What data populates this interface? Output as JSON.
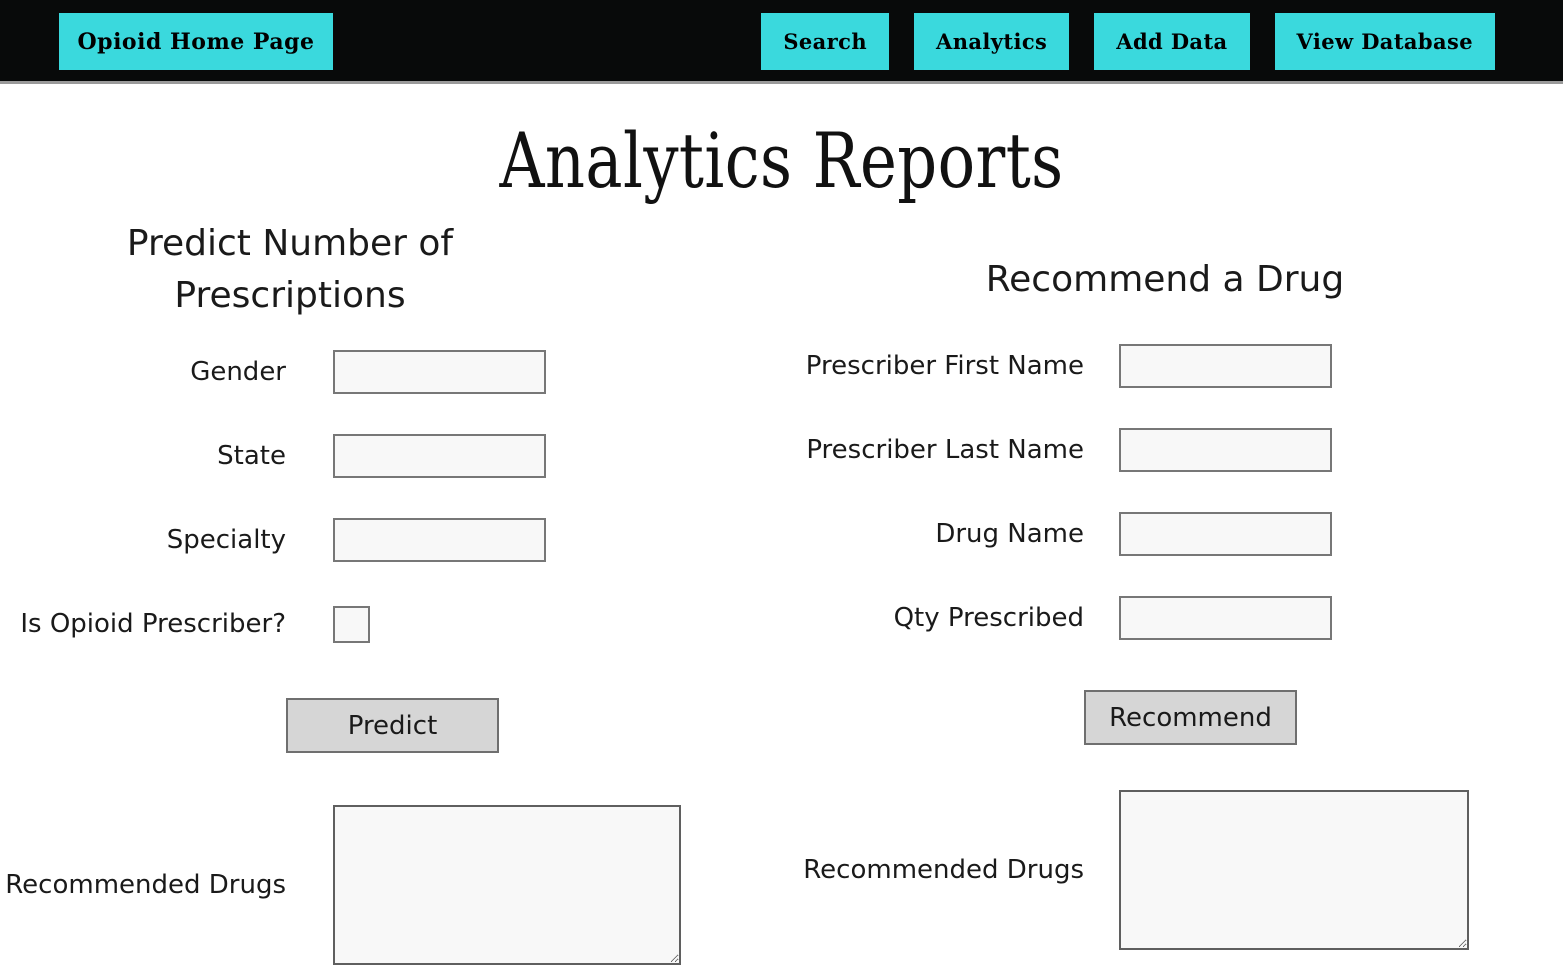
{
  "navbar": {
    "brand": "Opioid Home Page",
    "links": [
      {
        "label": "Search"
      },
      {
        "label": "Analytics"
      },
      {
        "label": "Add Data"
      },
      {
        "label": "View Database"
      }
    ],
    "background_color": "#080a0a",
    "button_color": "#3ad9dd"
  },
  "page": {
    "title": "Analytics Reports",
    "background_color": "#ffffff"
  },
  "predict_panel": {
    "heading": "Predict Number of Prescriptions",
    "fields": [
      {
        "label": "Gender",
        "value": "",
        "type": "text"
      },
      {
        "label": "State",
        "value": "",
        "type": "text"
      },
      {
        "label": "Specialty",
        "value": "",
        "type": "text"
      },
      {
        "label": "Is Opioid Prescriber?",
        "value": "",
        "type": "checkbox",
        "checked": false
      }
    ],
    "submit_label": "Predict",
    "output": {
      "label": "Recommended Drugs",
      "value": ""
    }
  },
  "recommend_panel": {
    "heading": "Recommend a Drug",
    "fields": [
      {
        "label": "Prescriber First Name",
        "value": "",
        "type": "text"
      },
      {
        "label": "Prescriber Last Name",
        "value": "",
        "type": "text"
      },
      {
        "label": "Drug Name",
        "value": "",
        "type": "text"
      },
      {
        "label": "Qty Prescribed",
        "value": "",
        "type": "text"
      }
    ],
    "submit_label": "Recommend",
    "output": {
      "label": "Recommended Drugs",
      "value": ""
    }
  }
}
